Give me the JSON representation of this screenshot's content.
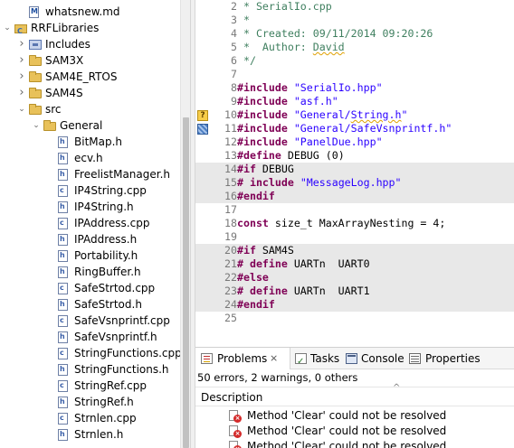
{
  "tree": {
    "rows": [
      {
        "label": "whatsnew.md",
        "icon": "markdown-file-icon",
        "twisty": ""
      },
      {
        "label": "RRFLibraries",
        "icon": "c-project-icon",
        "twisty": "expanded"
      },
      {
        "label": "Includes",
        "icon": "includes-icon",
        "twisty": "collapsed"
      },
      {
        "label": "SAM3X",
        "icon": "folder-icon",
        "twisty": "collapsed"
      },
      {
        "label": "SAM4E_RTOS",
        "icon": "folder-icon",
        "twisty": "collapsed"
      },
      {
        "label": "SAM4S",
        "icon": "folder-icon",
        "twisty": "collapsed"
      },
      {
        "label": "src",
        "icon": "folder-icon",
        "twisty": "expanded"
      },
      {
        "label": "General",
        "icon": "folder-icon",
        "twisty": "expanded"
      },
      {
        "label": "BitMap.h",
        "icon": "header-file-icon",
        "twisty": ""
      },
      {
        "label": "ecv.h",
        "icon": "header-file-icon",
        "twisty": ""
      },
      {
        "label": "FreelistManager.h",
        "icon": "header-file-icon",
        "twisty": ""
      },
      {
        "label": "IP4String.cpp",
        "icon": "cpp-file-icon",
        "twisty": ""
      },
      {
        "label": "IP4String.h",
        "icon": "header-file-icon",
        "twisty": ""
      },
      {
        "label": "IPAddress.cpp",
        "icon": "cpp-file-icon",
        "twisty": ""
      },
      {
        "label": "IPAddress.h",
        "icon": "header-file-icon",
        "twisty": ""
      },
      {
        "label": "Portability.h",
        "icon": "header-file-icon",
        "twisty": ""
      },
      {
        "label": "RingBuffer.h",
        "icon": "header-file-icon",
        "twisty": ""
      },
      {
        "label": "SafeStrtod.cpp",
        "icon": "cpp-file-icon",
        "twisty": ""
      },
      {
        "label": "SafeStrtod.h",
        "icon": "header-file-icon",
        "twisty": ""
      },
      {
        "label": "SafeVsnprintf.cpp",
        "icon": "cpp-file-icon",
        "twisty": ""
      },
      {
        "label": "SafeVsnprintf.h",
        "icon": "header-file-icon",
        "twisty": ""
      },
      {
        "label": "StringFunctions.cpp",
        "icon": "cpp-file-icon",
        "twisty": ""
      },
      {
        "label": "StringFunctions.h",
        "icon": "header-file-icon",
        "twisty": ""
      },
      {
        "label": "StringRef.cpp",
        "icon": "cpp-file-icon",
        "twisty": ""
      },
      {
        "label": "StringRef.h",
        "icon": "header-file-icon",
        "twisty": ""
      },
      {
        "label": "Strnlen.cpp",
        "icon": "cpp-file-icon",
        "twisty": ""
      },
      {
        "label": "Strnlen.h",
        "icon": "header-file-icon",
        "twisty": ""
      }
    ]
  },
  "editor": {
    "lines": [
      {
        "num": "2",
        "code": " * SerialIo.cpp"
      },
      {
        "num": "3",
        "code": " *"
      },
      {
        "num": "4",
        "code": " * Created: 09/11/2014 09:20:26"
      },
      {
        "num": "5",
        "code": " *  Author: David"
      },
      {
        "num": "6",
        "code": " */"
      },
      {
        "num": "7",
        "code": ""
      },
      {
        "num": "8",
        "code": "#include \"SerialIo.hpp\""
      },
      {
        "num": "9",
        "code": "#include \"asf.h\""
      },
      {
        "num": "10",
        "code": "#include \"General/String.h\""
      },
      {
        "num": "11",
        "code": "#include \"General/SafeVsnprintf.h\""
      },
      {
        "num": "12",
        "code": "#include \"PanelDue.hpp\""
      },
      {
        "num": "13",
        "code": "#define DEBUG (0)"
      },
      {
        "num": "14",
        "code": "#if DEBUG"
      },
      {
        "num": "15",
        "code": "# include \"MessageLog.hpp\""
      },
      {
        "num": "16",
        "code": "#endif"
      },
      {
        "num": "17",
        "code": ""
      },
      {
        "num": "18",
        "code": "const size_t MaxArrayNesting = 4;"
      },
      {
        "num": "19",
        "code": ""
      },
      {
        "num": "20",
        "code": "#if SAM4S"
      },
      {
        "num": "21",
        "code": "# define UARTn  UART0"
      },
      {
        "num": "22",
        "code": "#else"
      },
      {
        "num": "23",
        "code": "# define UARTn  UART1"
      },
      {
        "num": "24",
        "code": "#endif"
      },
      {
        "num": "25",
        "code": ""
      }
    ]
  },
  "panel": {
    "tabs": [
      {
        "label": "Problems",
        "close": "⨯",
        "icon": "problems-icon"
      },
      {
        "label": "Tasks",
        "icon": "tasks-icon"
      },
      {
        "label": "Console",
        "icon": "console-icon"
      },
      {
        "label": "Properties",
        "icon": "properties-icon"
      }
    ],
    "summary": "50 errors, 2 warnings, 0 others",
    "column_header": "Description",
    "sort_indicator": "^",
    "problems": [
      {
        "message": "Method 'Clear' could not be resolved",
        "icon": "error-icon"
      },
      {
        "message": "Method 'Clear' could not be resolved",
        "icon": "error-icon"
      },
      {
        "message": "Method 'Clear' could not be resolved",
        "icon": "error-icon"
      }
    ]
  },
  "colors": {
    "comment": "#3f7f5f",
    "preprocessor": "#7f0055",
    "string": "#2a00ff",
    "line_number": "#787878",
    "inactive_highlight": "#e8e8e8"
  }
}
